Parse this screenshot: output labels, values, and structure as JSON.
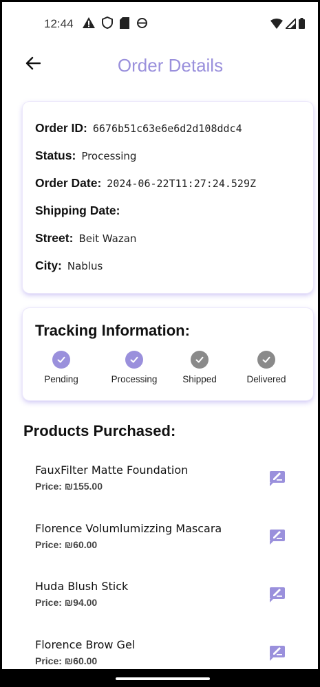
{
  "status_bar": {
    "time": "12:44",
    "icons_left": [
      "warning-icon",
      "shield-icon",
      "sd-card-icon",
      "sync-icon"
    ],
    "icons_right": [
      "wifi-icon",
      "signal-icon",
      "battery-icon"
    ]
  },
  "app_bar": {
    "title": "Order Details",
    "title_color": "#9a90dc",
    "back_icon": "arrow-back-icon"
  },
  "order": {
    "id_label": "Order ID:",
    "id_value": "6676b51c63e6e6d2d108ddc4",
    "status_label": "Status:",
    "status_value": "Processing",
    "date_label": "Order Date:",
    "date_value": "2024-06-22T11:27:24.529Z",
    "shipping_label": "Shipping Date:",
    "shipping_value": "",
    "street_label": "Street:",
    "street_value": "Beit Wazan",
    "city_label": "City:",
    "city_value": "Nablus"
  },
  "tracking": {
    "title": "Tracking Information:",
    "active_color": "#9a90dc",
    "inactive_color": "#8a8a8a",
    "steps": [
      {
        "label": "Pending",
        "done": true
      },
      {
        "label": "Processing",
        "done": true
      },
      {
        "label": "Shipped",
        "done": false
      },
      {
        "label": "Delivered",
        "done": false
      }
    ]
  },
  "products": {
    "title": "Products Purchased:",
    "items": [
      {
        "name": "FauxFilter Matte Foundation",
        "price": "Price: ₪155.00"
      },
      {
        "name": "Florence Volumlumizzing Mascara",
        "price": "Price: ₪60.00"
      },
      {
        "name": "Huda Blush Stick",
        "price": "Price: ₪94.00"
      },
      {
        "name": "Florence Brow Gel",
        "price": "Price: ₪60.00"
      }
    ],
    "edit_icon": "rate-review-icon"
  }
}
